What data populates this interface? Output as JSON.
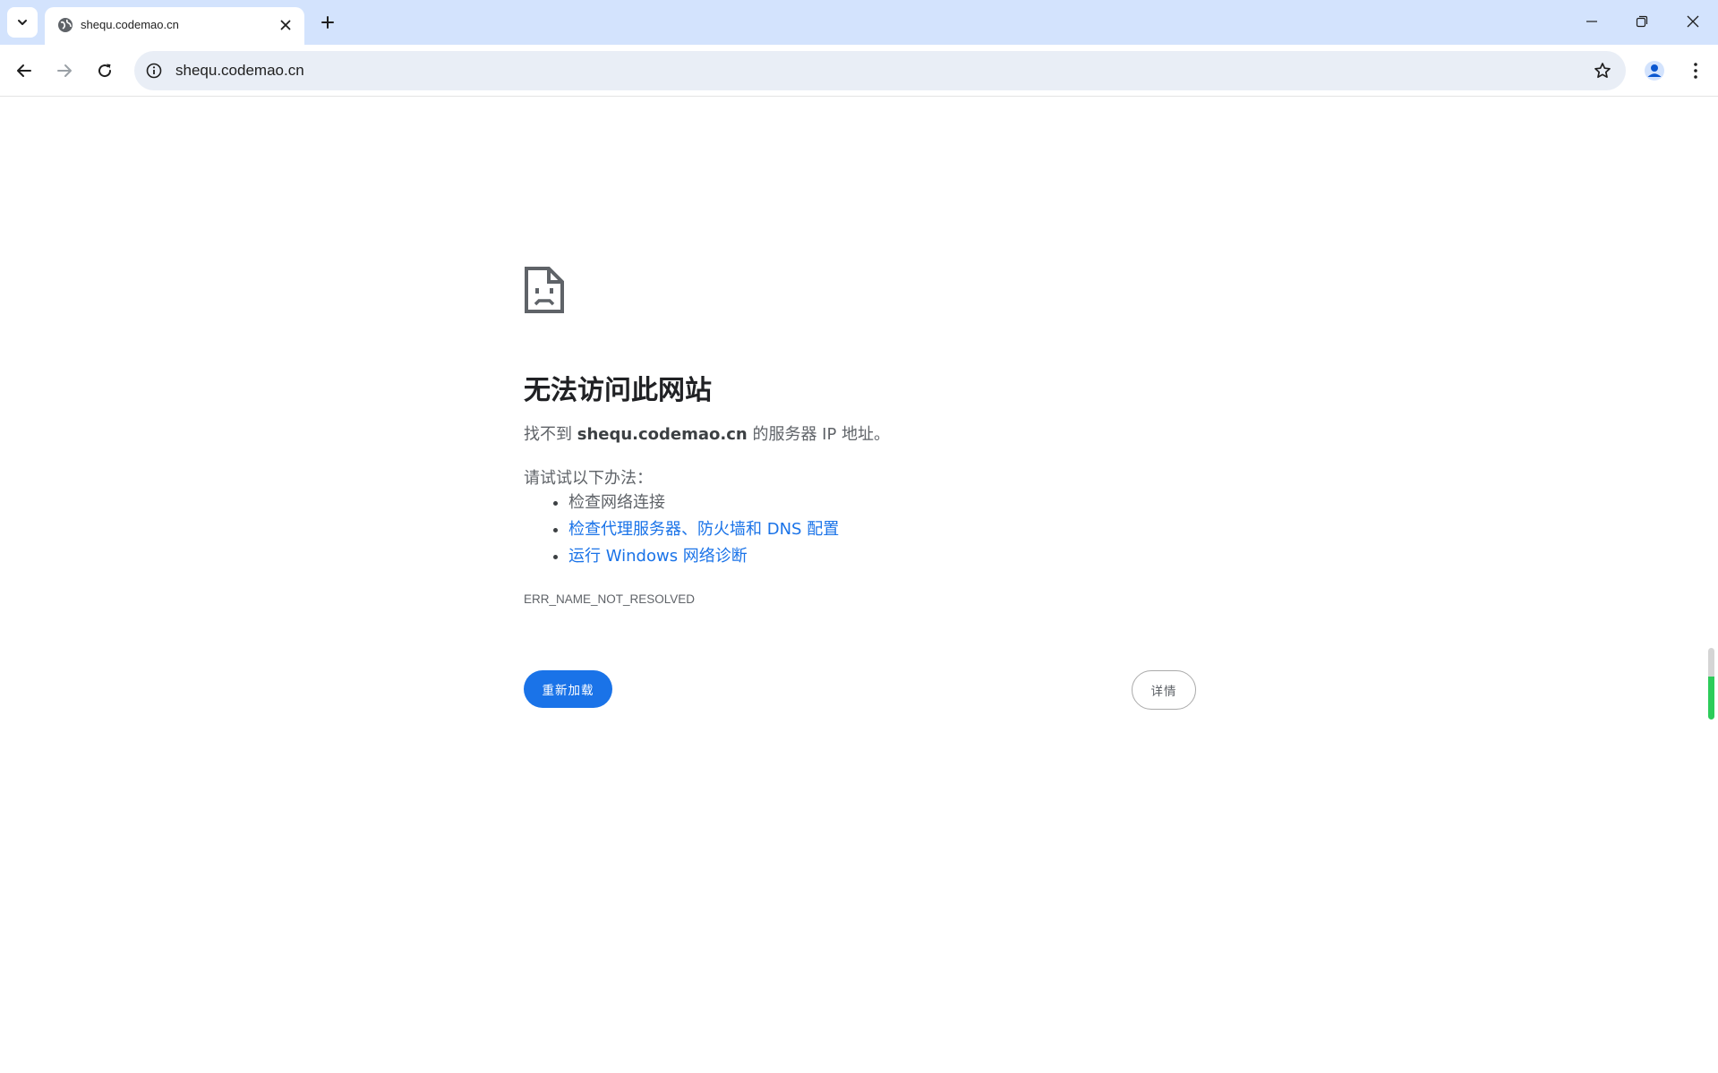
{
  "browser": {
    "tab": {
      "title": "shequ.codemao.cn"
    },
    "omnibox": {
      "url": "shequ.codemao.cn"
    },
    "icons": {
      "tab_search": "chevron-down-icon",
      "favicon": "globe-icon",
      "tab_close": "close-icon",
      "new_tab": "plus-icon",
      "minimize": "minimize-icon",
      "restore": "restore-icon",
      "close_window": "close-icon",
      "back": "back-arrow-icon",
      "forward": "forward-arrow-icon",
      "reload": "reload-icon",
      "site_info": "info-icon",
      "bookmark": "star-icon",
      "profile": "profile-icon",
      "menu": "kebab-menu-icon"
    }
  },
  "error_page": {
    "icon": "sad-document-icon",
    "title": "无法访问此网站",
    "desc_prefix": "找不到 ",
    "desc_host": "shequ.codemao.cn",
    "desc_suffix": " 的服务器 IP 地址。",
    "suggestions_title": "请试试以下办法：",
    "suggestions": [
      "检查网络连接",
      "检查代理服务器、防火墙和 DNS 配置",
      "运行 Windows 网络诊断"
    ],
    "error_code": "ERR_NAME_NOT_RESOLVED",
    "reload_label": "重新加载",
    "details_label": "详情"
  },
  "colors": {
    "tabstrip_bg": "#d3e3fd",
    "omnibox_bg": "#e9eef6",
    "link": "#1a73e8",
    "primary_button": "#1a73e8",
    "text_secondary": "#5f6368",
    "title_text": "#202124"
  }
}
